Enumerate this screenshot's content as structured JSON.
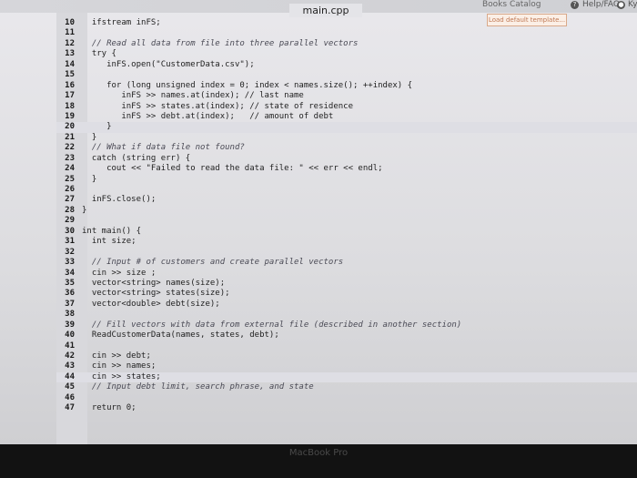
{
  "topbar": {
    "catalog_label": "Books Catalog",
    "help_label": "Help/FAQ",
    "user_label": "Kyl"
  },
  "editor": {
    "file_title": "main.cpp",
    "load_template_label": "Load default template..."
  },
  "code_lines": [
    {
      "n": "10",
      "text": "  ifstream inFS;",
      "comment": false
    },
    {
      "n": "11",
      "text": "",
      "comment": false
    },
    {
      "n": "12",
      "text": "  // Read all data from file into three parallel vectors",
      "comment": true
    },
    {
      "n": "13",
      "text": "  try {",
      "comment": false
    },
    {
      "n": "14",
      "text": "     inFS.open(\"CustomerData.csv\");",
      "comment": false
    },
    {
      "n": "15",
      "text": "",
      "comment": false
    },
    {
      "n": "16",
      "text": "     for (long unsigned index = 0; index < names.size(); ++index) {",
      "comment": false
    },
    {
      "n": "17",
      "text": "        inFS >> names.at(index); // last name",
      "comment": false
    },
    {
      "n": "18",
      "text": "        inFS >> states.at(index); // state of residence",
      "comment": false
    },
    {
      "n": "19",
      "text": "        inFS >> debt.at(index);   // amount of debt",
      "comment": false
    },
    {
      "n": "20",
      "text": "     }",
      "comment": false
    },
    {
      "n": "21",
      "text": "  }",
      "comment": false
    },
    {
      "n": "22",
      "text": "  // What if data file not found?",
      "comment": true
    },
    {
      "n": "23",
      "text": "  catch (string err) {",
      "comment": false
    },
    {
      "n": "24",
      "text": "     cout << \"Failed to read the data file: \" << err << endl;",
      "comment": false
    },
    {
      "n": "25",
      "text": "  }",
      "comment": false
    },
    {
      "n": "26",
      "text": "",
      "comment": false
    },
    {
      "n": "27",
      "text": "  inFS.close();",
      "comment": false
    },
    {
      "n": "28",
      "text": "}",
      "comment": false
    },
    {
      "n": "29",
      "text": "",
      "comment": false
    },
    {
      "n": "30",
      "text": "int main() {",
      "comment": false
    },
    {
      "n": "31",
      "text": "  int size;",
      "comment": false
    },
    {
      "n": "32",
      "text": "",
      "comment": false
    },
    {
      "n": "33",
      "text": "  // Input # of customers and create parallel vectors",
      "comment": true
    },
    {
      "n": "34",
      "text": "  cin >> size ;",
      "comment": false
    },
    {
      "n": "35",
      "text": "  vector<string> names(size);",
      "comment": false
    },
    {
      "n": "36",
      "text": "  vector<string> states(size);",
      "comment": false
    },
    {
      "n": "37",
      "text": "  vector<double> debt(size);",
      "comment": false
    },
    {
      "n": "38",
      "text": "",
      "comment": false
    },
    {
      "n": "39",
      "text": "  // Fill vectors with data from external file (described in another section)",
      "comment": true
    },
    {
      "n": "40",
      "text": "  ReadCustomerData(names, states, debt);",
      "comment": false
    },
    {
      "n": "41",
      "text": "",
      "comment": false
    },
    {
      "n": "42",
      "text": "  cin >> debt;",
      "comment": false
    },
    {
      "n": "43",
      "text": "  cin >> names;",
      "comment": false
    },
    {
      "n": "44",
      "text": "  cin >> states;",
      "comment": false
    },
    {
      "n": "45",
      "text": "  // Input debt limit, search phrase, and state",
      "comment": true
    },
    {
      "n": "46",
      "text": "",
      "comment": false
    },
    {
      "n": "47",
      "text": "  return 0;",
      "comment": false
    }
  ],
  "highlight_lines": [
    "20",
    "44"
  ],
  "device": {
    "brand": "MacBook Pro"
  }
}
